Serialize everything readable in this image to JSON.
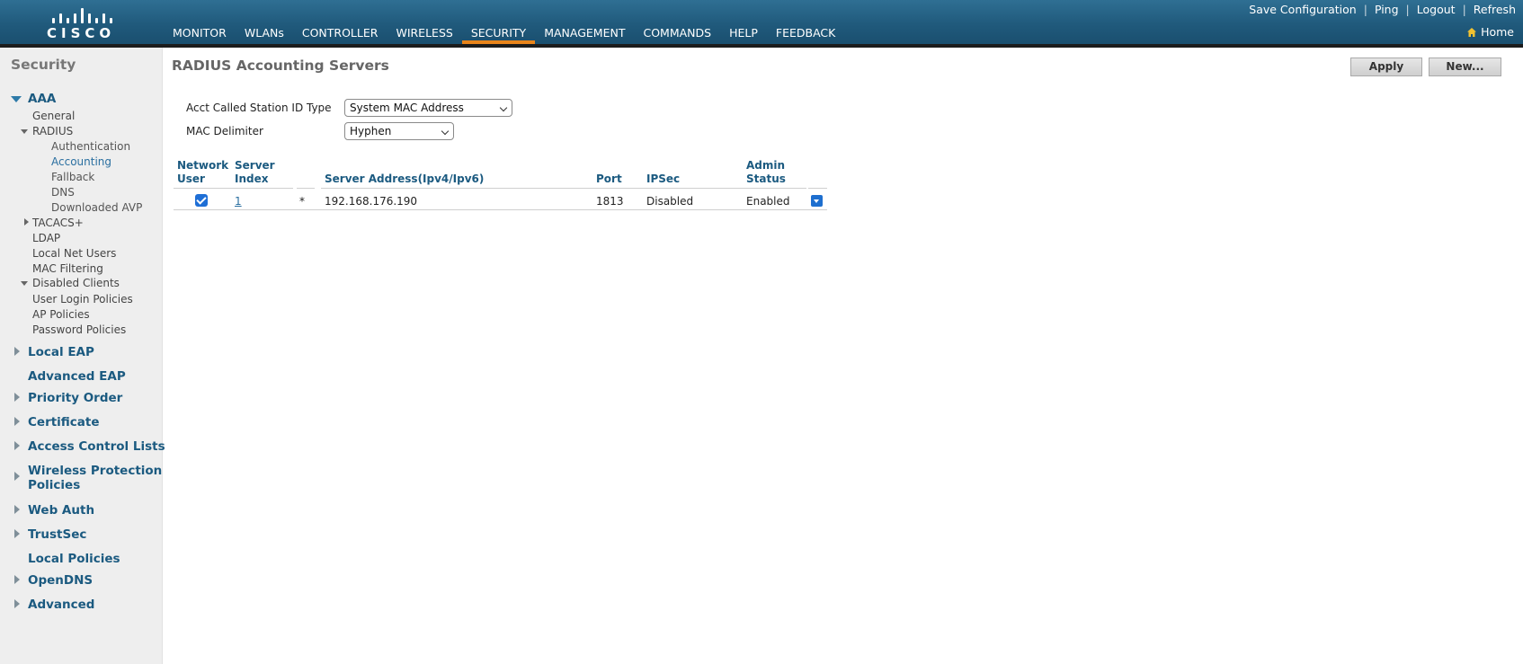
{
  "header": {
    "logo_text": "CISCO",
    "nav": [
      {
        "label": "MONITOR",
        "active": false
      },
      {
        "label": "WLANs",
        "active": false
      },
      {
        "label": "CONTROLLER",
        "active": false
      },
      {
        "label": "WIRELESS",
        "active": false
      },
      {
        "label": "SECURITY",
        "active": true
      },
      {
        "label": "MANAGEMENT",
        "active": false
      },
      {
        "label": "COMMANDS",
        "active": false
      },
      {
        "label": "HELP",
        "active": false
      },
      {
        "label": "FEEDBACK",
        "active": false
      }
    ],
    "top_links": [
      "Save Configuration",
      "Ping",
      "Logout",
      "Refresh"
    ],
    "home_label": "Home",
    "accent_color": "#e8841a"
  },
  "sidebar": {
    "title": "Security",
    "aaa": "AAA",
    "aaa_items": {
      "general": "General",
      "radius": "RADIUS",
      "radius_items": [
        "Authentication",
        "Accounting",
        "Fallback",
        "DNS",
        "Downloaded AVP"
      ],
      "tacacs": "TACACS+",
      "ldap": "LDAP",
      "local_net_users": "Local Net Users",
      "mac_filtering": "MAC Filtering",
      "disabled_clients": "Disabled Clients",
      "user_login_policies": "User Login Policies",
      "ap_policies": "AP Policies",
      "password_policies": "Password Policies"
    },
    "sections": [
      "Local EAP",
      "Advanced EAP",
      "Priority Order",
      "Certificate",
      "Access Control Lists",
      "Wireless Protection",
      "Policies",
      "Web Auth",
      "TrustSec",
      "Local Policies",
      "OpenDNS",
      "Advanced"
    ]
  },
  "main": {
    "title": "RADIUS Accounting Servers",
    "apply_label": "Apply",
    "new_label": "New...",
    "acct_called_station_label": "Acct Called Station ID Type",
    "acct_called_station_value": "System MAC Address",
    "mac_delimiter_label": "MAC Delimiter",
    "mac_delimiter_value": "Hyphen",
    "table": {
      "headers": {
        "network_user": [
          "Network",
          "User"
        ],
        "server_index": [
          "Server",
          "Index"
        ],
        "server_address": "Server Address(Ipv4/Ipv6)",
        "port": "Port",
        "ipsec": "IPSec",
        "admin_status": [
          "Admin",
          "Status"
        ]
      },
      "rows": [
        {
          "network_user_checked": true,
          "server_index": "1",
          "marker": "*",
          "server_address": "192.168.176.190",
          "port": "1813",
          "ipsec": "Disabled",
          "admin_status": "Enabled"
        }
      ]
    }
  }
}
